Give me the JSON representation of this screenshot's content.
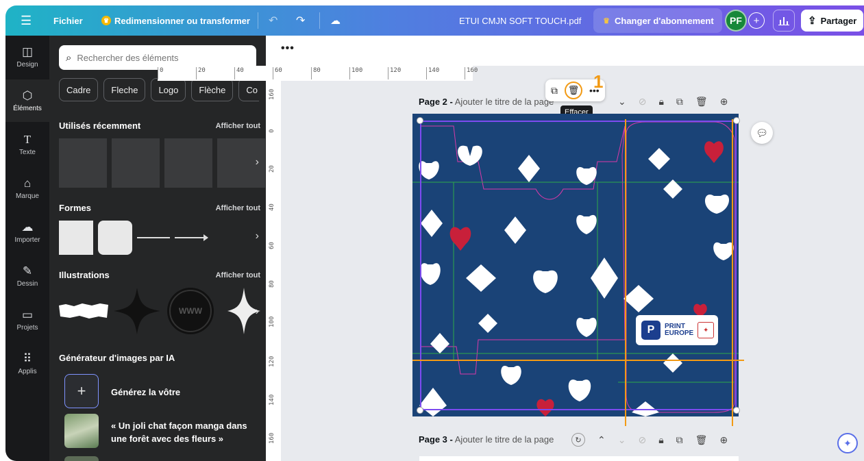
{
  "topbar": {
    "menu_icon": "menu-icon",
    "file_label": "Fichier",
    "resize_label": "Redimensionner ou transformer",
    "doc_name": "ETUI CMJN SOFT TOUCH.pdf",
    "upgrade_label": "Changer d'abonnement",
    "avatar_initials": "PF",
    "share_label": "Partager"
  },
  "rail": {
    "items": [
      {
        "label": "Design",
        "icon": "layout-icon"
      },
      {
        "label": "Éléments",
        "icon": "shapes-icon"
      },
      {
        "label": "Texte",
        "icon": "text-icon"
      },
      {
        "label": "Marque",
        "icon": "brand-icon"
      },
      {
        "label": "Importer",
        "icon": "upload-icon"
      },
      {
        "label": "Dessin",
        "icon": "draw-icon"
      },
      {
        "label": "Projets",
        "icon": "folder-icon"
      },
      {
        "label": "Applis",
        "icon": "apps-icon"
      }
    ]
  },
  "panel": {
    "search_placeholder": "Rechercher des éléments",
    "chips": [
      "Cadre",
      "Fleche",
      "Logo",
      "Flèche",
      "Co"
    ],
    "recent_title": "Utilisés récemment",
    "see_all": "Afficher tout",
    "shapes_title": "Formes",
    "illustrations_title": "Illustrations",
    "ai_title": "Générateur d'images par IA",
    "ai_generate": "Générez la vôtre",
    "ai_example": "« Un joli chat façon manga dans une forêt avec des fleurs »"
  },
  "canvas": {
    "ruler_h": [
      "0",
      "20",
      "40",
      "60",
      "80",
      "100",
      "120",
      "140",
      "160"
    ],
    "ruler_v": [
      "160",
      "0",
      "20",
      "40",
      "60",
      "80",
      "100",
      "120",
      "140",
      "160"
    ],
    "page2_name": "Page 2 -",
    "page2_sub": "Ajouter le titre de la page",
    "page3_name": "Page 3 -",
    "page3_sub": "Ajouter le titre de la page",
    "tooltip": "Effacer",
    "callout_number": "1",
    "logo_line1": "PRINT",
    "logo_line2": "EUROPE",
    "logo_letter": "P"
  },
  "colors": {
    "design_bg": "#1a4377",
    "guide": "#f29a14",
    "selection": "#7d4bf0",
    "heart_red": "#c8203a"
  }
}
